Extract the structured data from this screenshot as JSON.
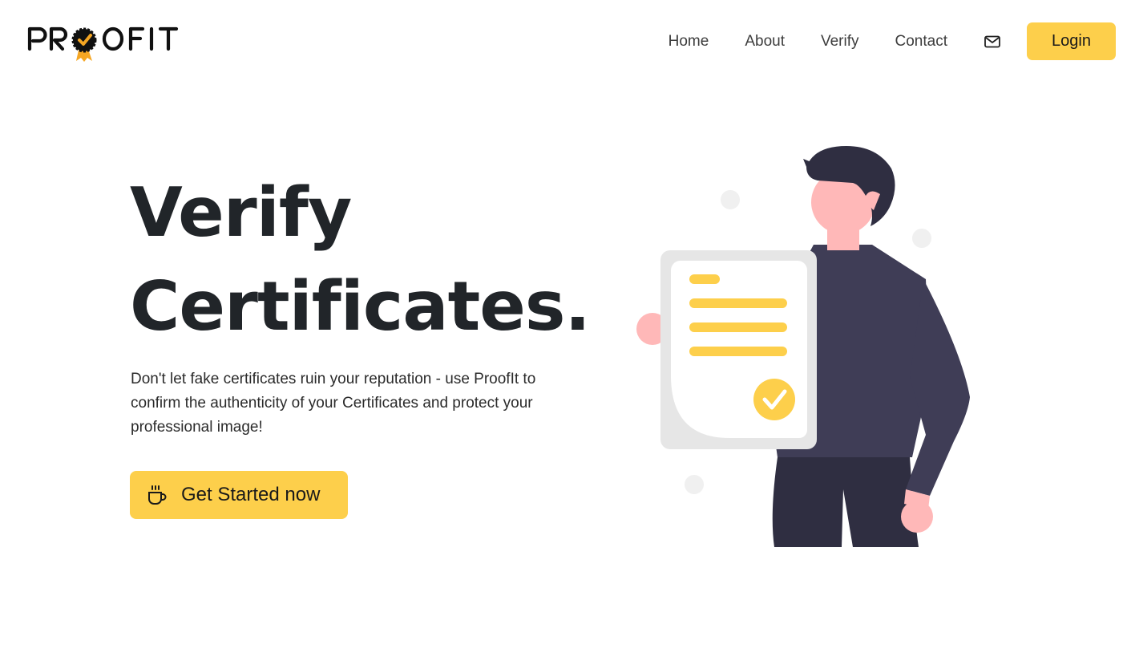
{
  "brand": {
    "logo_text": "PROOFIT",
    "accent_color": "#fdcf4b",
    "text_color": "#212529"
  },
  "nav": {
    "items": [
      {
        "label": "Home"
      },
      {
        "label": "About"
      },
      {
        "label": "Verify"
      },
      {
        "label": "Contact"
      }
    ],
    "mail_icon": "mail-icon",
    "login_label": "Login"
  },
  "hero": {
    "title_line1": "Verify",
    "title_line2": "Certificates.",
    "description": "Don't let fake certificates ruin your reputation - use ProofIt to confirm the authenticity of your Certificates and protect your professional image!",
    "cta_label": "Get Started now",
    "cta_icon": "cup-icon"
  },
  "illustration": {
    "name": "person-holding-certificate",
    "colors": {
      "shirt": "#3f3d56",
      "pants": "#2f2e41",
      "skin": "#ffb8b8",
      "hair": "#2f2e41",
      "paper": "#e6e6e6",
      "paper_inner": "#ffffff",
      "lines": "#fdcf4b",
      "dots": "#f0f0f0"
    }
  }
}
